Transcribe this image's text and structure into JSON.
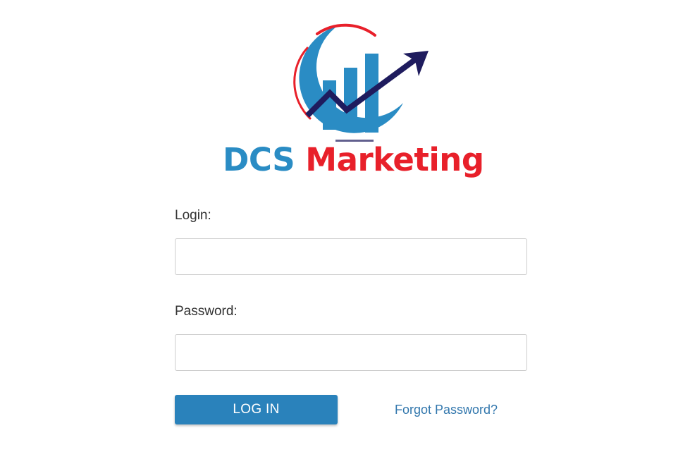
{
  "logo": {
    "brand_part1": "DCS",
    "brand_part2": "Marketing",
    "colors": {
      "blue": "#2a8cc4",
      "red": "#e8202a",
      "arrow": "#1f1c5e"
    }
  },
  "form": {
    "login_label": "Login:",
    "login_value": "",
    "password_label": "Password:",
    "password_value": "",
    "submit_label": "LOG IN",
    "forgot_label": "Forgot Password?"
  },
  "colors": {
    "button": "#2a82bb",
    "link": "#3277ad"
  }
}
